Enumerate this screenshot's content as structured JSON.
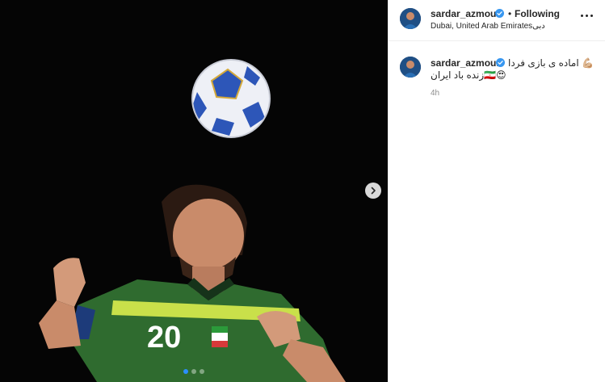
{
  "post": {
    "carousel": {
      "slides": 3,
      "active_index": 0
    },
    "header": {
      "username": "sardar_azmoun",
      "follow_status": "Following",
      "bullet": "•",
      "location": "Dubai, United Arab Emiratesدبی"
    },
    "caption": {
      "username": "sardar_azmoun",
      "line1": "اماده ی بازی فردا 💪🏼",
      "line2": "زنده باد ایران🇮🇷😍",
      "timestamp": "4h"
    },
    "photo": {
      "jersey_number": "20"
    }
  },
  "icons": {
    "verified": "verified-badge-icon",
    "more": "more-options-icon",
    "next": "chevron-right-icon"
  },
  "colors": {
    "verified_blue": "#3897f0",
    "active_dot": "#2b8fff",
    "jersey_green": "#2f6b2f",
    "jersey_stripe": "#c9e04a"
  }
}
